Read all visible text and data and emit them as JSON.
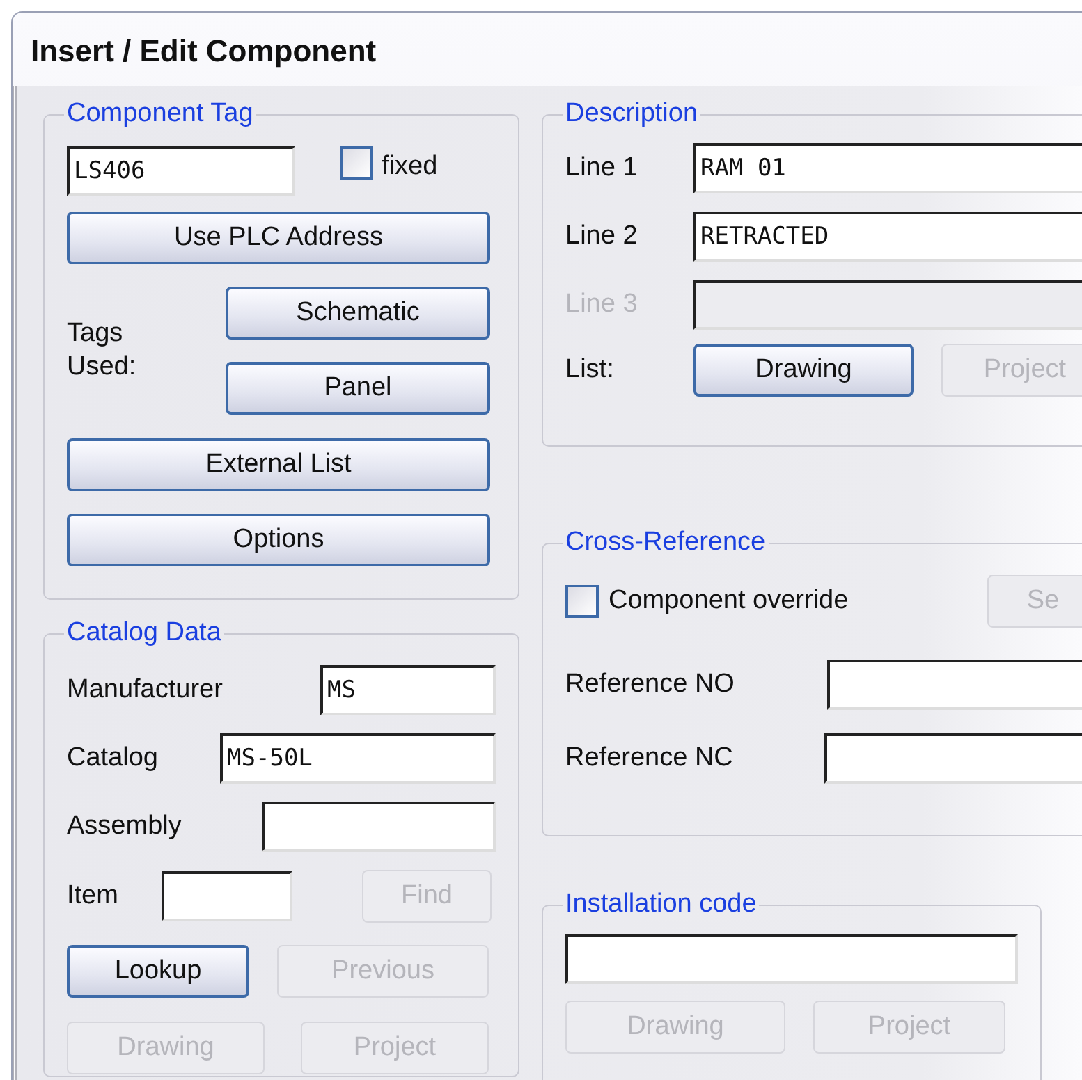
{
  "window": {
    "title": "Insert / Edit Component"
  },
  "component_tag": {
    "title": "Component Tag",
    "tag_field": {
      "value": "LS406"
    },
    "fixed": {
      "label": "fixed",
      "checked": false
    },
    "plc_button": {
      "label": "Use PLC Address",
      "disabled": false
    },
    "tags_used": {
      "label": "Tags Used:",
      "buttons": [
        {
          "label": "Schematic",
          "disabled": false
        },
        {
          "label": "Panel",
          "disabled": false
        }
      ]
    },
    "buttons": [
      {
        "label": "External List",
        "disabled": false
      },
      {
        "label": "Options",
        "disabled": false
      }
    ]
  },
  "catalog_data": {
    "title": "Catalog Data",
    "fields": [
      {
        "label": "Manufacturer",
        "value": "MS"
      },
      {
        "label": "Catalog",
        "value": "MS-50L"
      },
      {
        "label": "Assembly"
      },
      {
        "label": "Item"
      }
    ],
    "find_button": {
      "label": "Find",
      "disabled": true
    },
    "buttons": [
      {
        "label": "Lookup",
        "disabled": false
      },
      {
        "label": "Previous",
        "disabled": true
      },
      {
        "label": "Drawing",
        "disabled": true
      },
      {
        "label": "Project",
        "disabled": true
      }
    ]
  },
  "description": {
    "title": "Description",
    "lines": [
      {
        "label": "Line 1",
        "value": "RAM 01",
        "disabled": false
      },
      {
        "label": "Line 2",
        "value": "RETRACTED",
        "disabled": false
      },
      {
        "label": "Line 3",
        "disabled": true
      }
    ],
    "list_label": "List:",
    "buttons": [
      {
        "label": "Drawing",
        "disabled": false
      },
      {
        "label": "Project",
        "disabled": true
      }
    ]
  },
  "cross_reference": {
    "title": "Cross-Reference",
    "override": {
      "label": "Component override",
      "checked": false
    },
    "set_button": {
      "label": "Se",
      "disabled": true
    },
    "references": [
      {
        "label": "Reference NO"
      },
      {
        "label": "Reference NC"
      }
    ]
  },
  "installation_code": {
    "title": "Installation code",
    "buttons": [
      {
        "label": "Drawing",
        "disabled": true
      },
      {
        "label": "Project",
        "disabled": true
      }
    ]
  }
}
